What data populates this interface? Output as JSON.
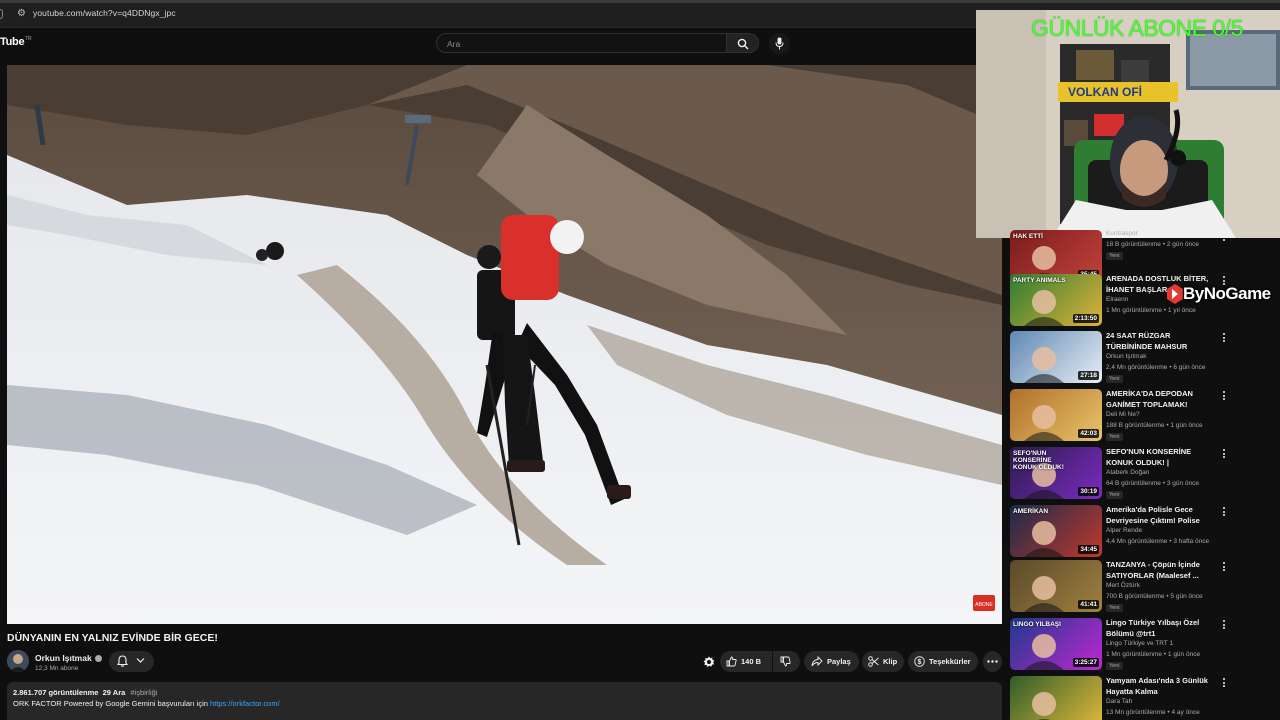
{
  "browser": {
    "url": "youtube.com/watch?v=q4DDNgx_jpc"
  },
  "header": {
    "logo_text": "Tube",
    "logo_suffix": "TR",
    "search_placeholder": "Ara"
  },
  "video": {
    "title": "DÜNYANIN EN YALNIZ EVİNDE BİR GECE!"
  },
  "channel": {
    "name": "Orkun Işıtmak",
    "subscribers": "12,3 Mn abone"
  },
  "actions": {
    "likes": "140 B",
    "share": "Paylaş",
    "clip": "Klip",
    "thanks": "Teşekkürler"
  },
  "description": {
    "views": "2.861.707 görüntülenme",
    "date": "29 Ara",
    "tag": "#işbirliği",
    "text": "ORK FACTOR Powered by Google Gemini başvuruları için",
    "link": "https://orkfactor.com/"
  },
  "overlay": {
    "counter": "GÜNLÜK ABONE 0/5",
    "sponsor": "ByNoGame"
  },
  "recommendations": [
    {
      "title": "",
      "channel": "Kontraspor",
      "meta": "18 B görüntülenme • 2 gün önce",
      "badge": "Yeni",
      "duration": "35:45",
      "thumb_text": "HAK ETTİ",
      "colors": [
        "#7a1d1d",
        "#c2413b"
      ]
    },
    {
      "title": "ARENADA DOSTLUK BİTER, İHANET BAŞLAR",
      "channel": "Elraenn",
      "meta": "1 Mn görüntülenme • 1 yıl önce",
      "badge": "",
      "duration": "2:13:50",
      "thumb_text": "PARTY ANIMALS",
      "colors": [
        "#2d7d32",
        "#e0b23a"
      ]
    },
    {
      "title": "24 SAAT RÜZGAR TÜRBİNİNDE MAHSUR KALMAK!",
      "channel": "Orkun Işıtmak",
      "meta": "2,4 Mn görüntülenme • 6 gün önce",
      "badge": "Yeni",
      "duration": "27:18",
      "thumb_text": "",
      "colors": [
        "#5f88b3",
        "#e8eef5"
      ]
    },
    {
      "title": "AMERİKA'DA DEPODAN GANİMET TOPLAMAK!",
      "channel": "Deli Mi Ne?",
      "meta": "188 B görüntülenme • 1 gün önce",
      "badge": "Yeni",
      "duration": "42:03",
      "thumb_text": "",
      "colors": [
        "#b06f2b",
        "#e9c46a"
      ]
    },
    {
      "title": "SEFO'NUN KONSERİNE KONUK OLDUK! | KONSERDEN SAHNE ...",
      "channel": "Ataberk Doğan",
      "meta": "64 B görüntülenme • 3 gün önce",
      "badge": "Yeni",
      "duration": "30:19",
      "thumb_text": "SEFO'NUN KONSERİNE KONUK OLDUK!",
      "colors": [
        "#2a1b4d",
        "#7b2cbf"
      ]
    },
    {
      "title": "Amerika'da Polisle Gece Devriyesine Çıktım! Polise Küf...",
      "channel": "Alper Rende",
      "meta": "4,4 Mn görüntülenme • 3 hafta önce",
      "badge": "",
      "duration": "34:45",
      "thumb_text": "AMERİKAN",
      "colors": [
        "#1b2a4d",
        "#c0392b"
      ]
    },
    {
      "title": "TANZANYA - Çöpün İçinde SATIYORLAR (Maalesef ...",
      "channel": "Mert Öztürk",
      "meta": "700 B görüntülenme • 5 gün önce",
      "badge": "Yeni",
      "duration": "41:41",
      "thumb_text": "",
      "colors": [
        "#5a4a2a",
        "#a08040"
      ]
    },
    {
      "title": "Lingo Türkiye Yılbaşı Özel Bölümü @trt1",
      "channel": "Lingo Türkiye ve TRT 1",
      "meta": "1 Mn görüntülenme • 1 gün önce",
      "badge": "Yeni",
      "duration": "3:25:27",
      "thumb_text": "LINGO YILBAŞI",
      "colors": [
        "#1e3a8a",
        "#c026d3"
      ]
    },
    {
      "title": "Yamyam Adası'nda 3 Günlük Hayatta Kalma",
      "channel": "Dara Tah",
      "meta": "13 Mn görüntülenme • 4 ay önce",
      "badge": "",
      "duration": "",
      "thumb_text": "",
      "colors": [
        "#2f5d2a",
        "#e2b93b"
      ]
    }
  ]
}
